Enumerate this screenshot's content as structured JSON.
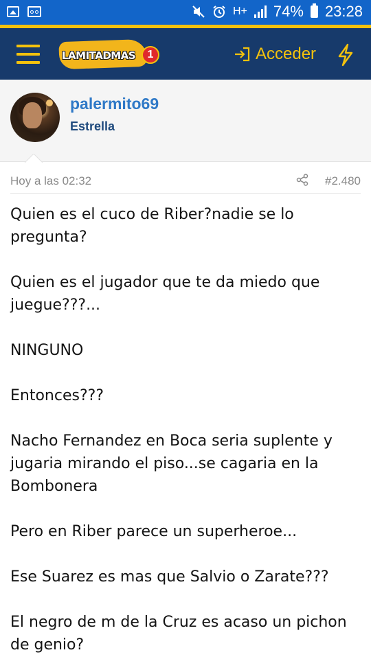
{
  "status_bar": {
    "battery_percent": "74%",
    "time": "23:28",
    "network": "H+",
    "icons": [
      "image-icon",
      "voicemail-icon",
      "mute-icon",
      "alarm-icon",
      "signal-icon",
      "battery-icon"
    ]
  },
  "header": {
    "logo_text": "LAMITADMAS",
    "logo_number": "1",
    "login_label": "Acceder",
    "menu_icon": "hamburger-icon",
    "login_icon": "sign-in-icon",
    "bolt_icon": "lightning-icon",
    "colors": {
      "bar": "#173a6b",
      "accent": "#f4c20d"
    }
  },
  "user": {
    "name": "palermito69",
    "title": "Estrella",
    "colors": {
      "name": "#2f79c7",
      "title": "#1f4a7d"
    }
  },
  "post": {
    "time": "Hoy a las 02:32",
    "number": "#2.480",
    "share_icon": "share-icon",
    "paragraphs": [
      "Quien es el cuco de Riber?nadie se lo pregunta?",
      "Quien es el jugador que te da miedo que juegue???...",
      "NINGUNO",
      "Entonces???",
      "Nacho Fernandez en Boca seria suplente y jugaria mirando el piso...se cagaria en la Bombonera",
      "Pero en Riber parece un superheroe...",
      "Ese Suarez es mas que Salvio o Zarate???",
      "El negro de m de la Cruz es acaso un pichon de genio?"
    ]
  }
}
